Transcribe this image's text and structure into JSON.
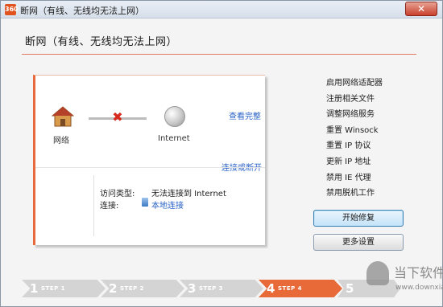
{
  "window": {
    "title": "断网（有线、无线均无法上网）",
    "app_icon": "360"
  },
  "header": {
    "title": "断网（有线、无线均无法上网）"
  },
  "diagnostic": {
    "network_label": "网络",
    "internet_label": "Internet",
    "view_link": "查看完整",
    "disconnect_link": "连接或断开",
    "access_type_label": "访问类型:",
    "access_type_value": "无法连接到 Internet",
    "connection_label": "连接:",
    "connection_value": "本地连接"
  },
  "actions": [
    "启用网络适配器",
    "注册相关文件",
    "调整网络服务",
    "重置 Winsock",
    "重置 IP 协议",
    "更新 IP 地址",
    "禁用 IE 代理",
    "禁用脱机工作"
  ],
  "buttons": {
    "start_repair": "开始修复",
    "more_settings": "更多设置"
  },
  "steps": [
    {
      "num": "1",
      "label": "STEP 1",
      "active": false
    },
    {
      "num": "2",
      "label": "STEP 2",
      "active": false
    },
    {
      "num": "3",
      "label": "STEP 3",
      "active": false
    },
    {
      "num": "4",
      "label": "STEP 4",
      "active": true
    },
    {
      "num": "5",
      "label": "",
      "active": false
    }
  ],
  "watermark": {
    "brand": "当下软件园",
    "url": "www.downxia.com"
  },
  "colors": {
    "accent": "#e86a38",
    "link": "#2a63c7",
    "error": "#d62a1e"
  },
  "icons": [
    "house-icon",
    "x-mark-icon",
    "globe-icon",
    "connection-icon",
    "close-icon"
  ]
}
